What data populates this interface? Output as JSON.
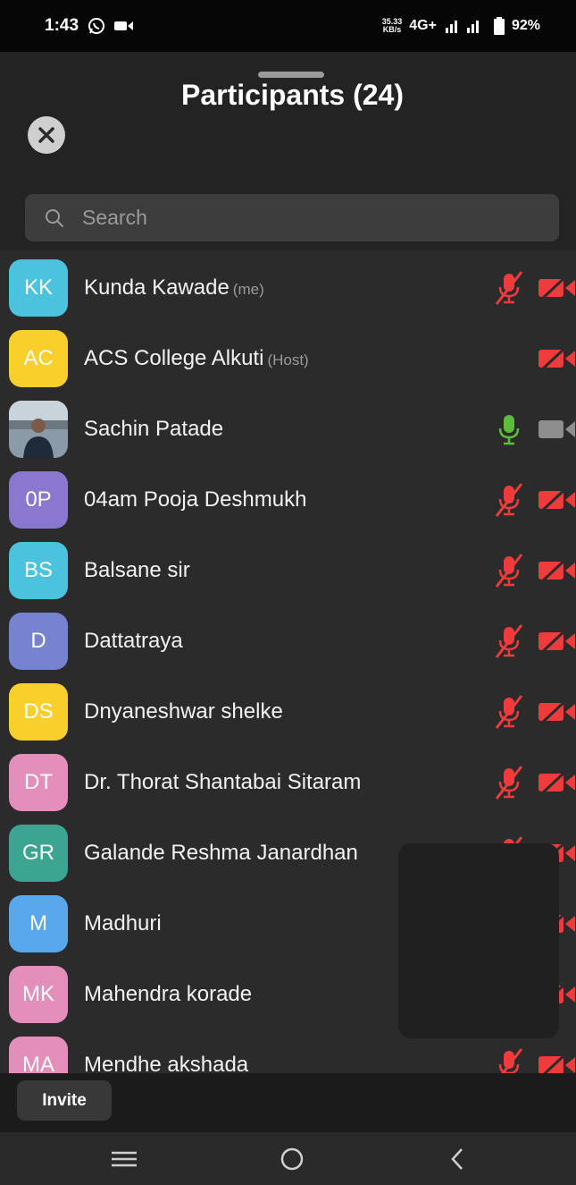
{
  "status": {
    "time": "1:43",
    "speed_value": "35.33",
    "speed_unit": "KB/s",
    "network": "4G+",
    "battery": "92%"
  },
  "header": {
    "title": "Participants (24)"
  },
  "search": {
    "placeholder": "Search"
  },
  "participants": [
    {
      "initials": "KK",
      "name": "Kunda Kawade",
      "tag": "(me)",
      "avatar_color": "#4cc3de",
      "mic": "muted",
      "video": "off"
    },
    {
      "initials": "AC",
      "name": "ACS College Alkuti",
      "tag": "(Host)",
      "avatar_color": "#f9cf2c",
      "mic": "none",
      "video": "off"
    },
    {
      "initials": "",
      "name": "Sachin Patade",
      "tag": "",
      "avatar_color": "photo",
      "mic": "on",
      "video": "on"
    },
    {
      "initials": "0P",
      "name": "04am Pooja Deshmukh",
      "tag": "",
      "avatar_color": "#8a78d0",
      "mic": "muted",
      "video": "off"
    },
    {
      "initials": "BS",
      "name": "Balsane sir",
      "tag": "",
      "avatar_color": "#4cc3de",
      "mic": "muted",
      "video": "off"
    },
    {
      "initials": "D",
      "name": "Dattatraya",
      "tag": "",
      "avatar_color": "#7683d0",
      "mic": "muted",
      "video": "off"
    },
    {
      "initials": "DS",
      "name": "Dnyaneshwar shelke",
      "tag": "",
      "avatar_color": "#f9cf2c",
      "mic": "muted",
      "video": "off"
    },
    {
      "initials": "DT",
      "name": "Dr. Thorat Shantabai Sitaram",
      "tag": "",
      "avatar_color": "#e38fba",
      "mic": "muted",
      "video": "off"
    },
    {
      "initials": "GR",
      "name": "Galande Reshma Janardhan",
      "tag": "",
      "avatar_color": "#3ba592",
      "mic": "muted",
      "video": "off"
    },
    {
      "initials": "M",
      "name": "Madhuri",
      "tag": "",
      "avatar_color": "#5aa8ec",
      "mic": "muted",
      "video": "off"
    },
    {
      "initials": "MK",
      "name": "Mahendra korade",
      "tag": "",
      "avatar_color": "#e38fba",
      "mic": "muted",
      "video": "off"
    },
    {
      "initials": "MA",
      "name": "Mendhe akshada",
      "tag": "",
      "avatar_color": "#e38fba",
      "mic": "muted",
      "video": "off"
    }
  ],
  "footer": {
    "invite_label": "Invite"
  },
  "colors": {
    "muted_red": "#ef3b3b",
    "mic_on_green": "#5bbd3a",
    "cam_on_gray": "#8e8e8e"
  }
}
